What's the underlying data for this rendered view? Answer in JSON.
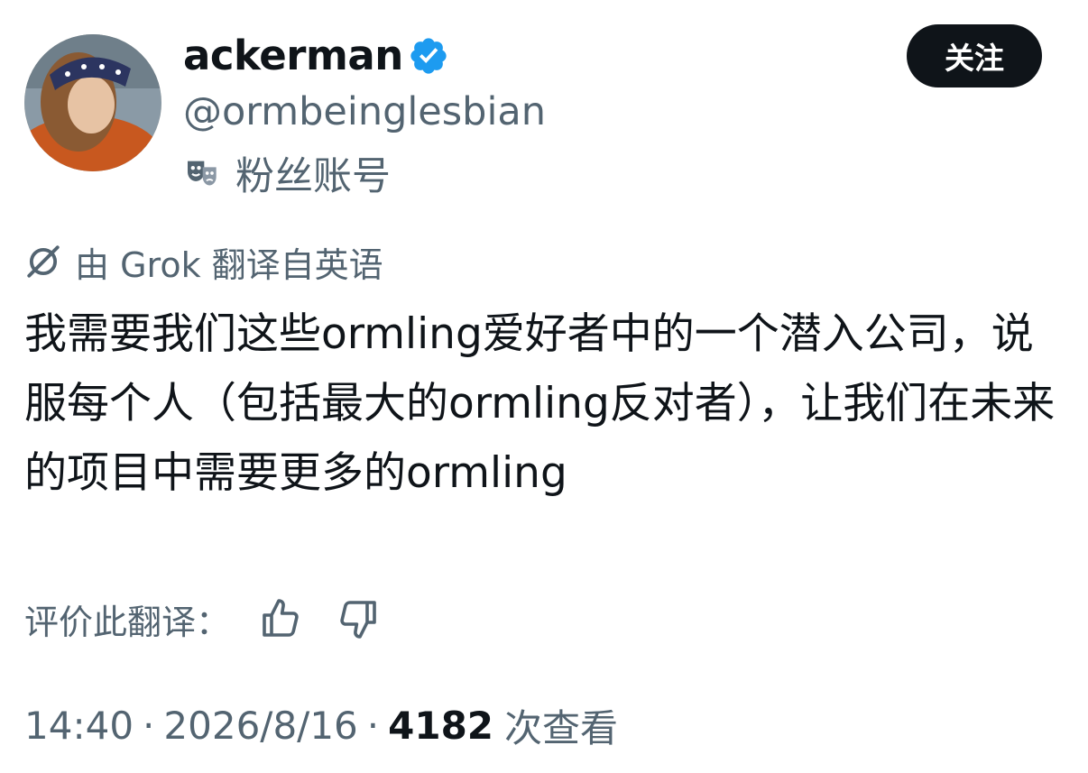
{
  "user": {
    "display_name": "ackerman",
    "handle": "@ormbeinglesbian",
    "badge_label": "粉丝账号",
    "verified_color": "#1d9bf0"
  },
  "follow_button": {
    "label": "关注"
  },
  "translation": {
    "label": "由 Grok 翻译自英语"
  },
  "tweet": {
    "text": "我需要我们这些ormling爱好者中的一个潜入公司，说服每个人（包括最大的ormling反对者），让我们在未来的项目中需要更多的ormling"
  },
  "rating": {
    "label": "评价此翻译：",
    "like_icon": "thumbs-up-icon",
    "dislike_icon": "thumbs-down-icon"
  },
  "meta": {
    "time": "14:40",
    "separator": "·",
    "date": "2026/8/16",
    "views_count": "4182",
    "views_label": "次查看"
  },
  "colors": {
    "primary_text": "#0f1419",
    "secondary_text": "#536471",
    "button_bg": "#0f1419"
  }
}
